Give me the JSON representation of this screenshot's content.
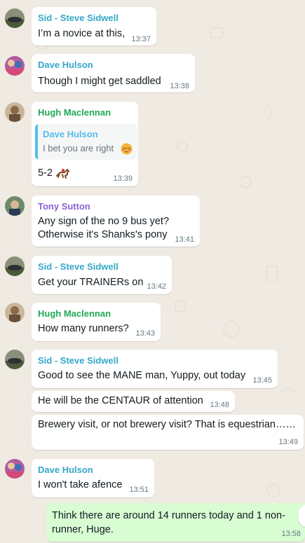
{
  "colors": {
    "background": "#efeae2",
    "incoming_bubble": "#ffffff",
    "outgoing_bubble": "#d9fdd3",
    "sid": "#35a8c9",
    "dave": "#35a8c9",
    "hugh": "#1fa855",
    "tony": "#8a62d6",
    "timestamp": "#667781",
    "quote_accent": "#53bdeb"
  },
  "messages": [
    {
      "sender": "",
      "text": "I’m a novice at this,",
      "time": "13:37"
    },
    {
      "sender": "Dave Hulson",
      "text": "Though I might get saddled",
      "time": "13:38"
    },
    {
      "sender": "Hugh Maclennan",
      "quote_sender": "Dave Hulson",
      "quote_text": "I bet you are right",
      "quote_emoji": "relieved-face-emoji",
      "text": "5-2",
      "text_emoji": "horse-racing-emoji",
      "time": "13:39"
    },
    {
      "sender": "Tony Sutton",
      "text_line1": "Any sign of the no 9 bus yet?",
      "text_line2": "Otherwise it's Shanks's pony",
      "time": "13:41"
    },
    {
      "sender": "Sid - Steve Sidwell",
      "text": "Get your TRAINERs on",
      "time": "13:42"
    },
    {
      "sender": "Hugh Maclennan",
      "text": "How many runners?",
      "time": "13:43"
    },
    {
      "sender": "Sid - Steve Sidwell",
      "text": "Good to see the MANE man, Yuppy, out today",
      "time": "13:45"
    },
    {
      "sender": "",
      "text": "He will be the CENTAUR of attention",
      "time": "13:48"
    },
    {
      "sender": "",
      "text": "Brewery visit, or not brewery visit? That is equestrian……",
      "time": "13:49"
    },
    {
      "sender": "Dave Hulson",
      "text": "I won't take afence",
      "time": "13:51"
    },
    {
      "sender": "",
      "text_line1": "Think there are around 14 runners today and 1 non-",
      "text_line2": "runner, Huge.",
      "time": "13:58"
    }
  ],
  "top_sender": "Sid - Steve Sidwell"
}
